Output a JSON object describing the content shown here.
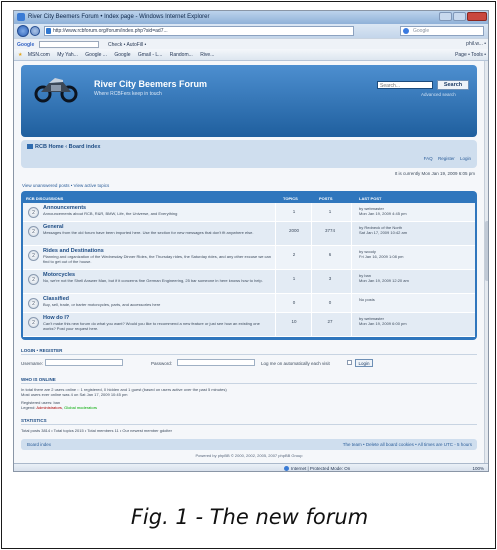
{
  "window": {
    "title": "River City Beemers Forum • Index page - Windows Internet Explorer",
    "url": "http://www.rcbforum.org/forum/index.php?sid=ad7...",
    "search_placeholder": "Google"
  },
  "googlebar": {
    "logo": "Google",
    "tools": "Check • AutoFill • ",
    "right": "phil.w... •"
  },
  "favorites": {
    "items": [
      "MSN.com",
      "My Yah...",
      "Google ...",
      "Google",
      "Gmail - L...",
      "Random...",
      "Rive..."
    ],
    "commands": "Page • Tools •"
  },
  "header": {
    "title": "River City Beemers Forum",
    "description": "Where RCBFers keep in touch",
    "search_placeholder": "Search...",
    "search_button": "Search",
    "advanced": "Advanced search"
  },
  "nav": {
    "breadcrumb": "RCB Home ‹ Board index",
    "faq": "FAQ",
    "register": "Register",
    "login": "Login",
    "current_time": "It is currently Mon Jan 19, 2009 6:05 pm"
  },
  "search_links": "View unanswered posts • View active topics",
  "forum_table": {
    "headers": {
      "forum": "RCB Discussions",
      "topics": "Topics",
      "posts": "Posts",
      "last_post": "Last post"
    },
    "rows": [
      {
        "name": "Announcements",
        "desc": "Announcements about RCB, R&R, BMW, Life, the Universe, and Everything",
        "topics": "1",
        "posts": "1",
        "last": "by webmaster\nMon Jan 19, 2009 4:45 pm"
      },
      {
        "name": "General",
        "desc": "Messages from the old forum have been imported here. Use the section for new messages that don't fit anywhere else.",
        "topics": "2000",
        "posts": "3774",
        "last": "by Redneck of the North\nSat Jan 17, 2009 10:42 am"
      },
      {
        "name": "Rides and Destinations",
        "desc": "Planning and organization of the Wednesday Dinner Rides, the Thursday rides, the Saturday rides, and any other excuse we can find to get out of the house.",
        "topics": "2",
        "posts": "6",
        "last": "by woody\nFri Jan 16, 2009 1:08 pm"
      },
      {
        "name": "Motorcycles",
        "desc": "No, we're not the Shell Answer Man, but if it concerns fine German Engineering, 25 bar someone in here knows how to help.",
        "topics": "1",
        "posts": "3",
        "last": "by ban\nMon Jan 19, 2009 12:20 am"
      },
      {
        "name": "Classified",
        "desc": "Buy, sell, trade, or barter motorcycles, parts, and accessories here",
        "topics": "0",
        "posts": "0",
        "last": "No posts"
      },
      {
        "name": "How do I?",
        "desc": "Can't make this new forum do what you want? Would you like to recommend a new feature or just see how an existing one works? Post your request here.",
        "topics": "10",
        "posts": "27",
        "last": "by webmaster\nMon Jan 19, 2009 6:00 pm"
      }
    ]
  },
  "login": {
    "heading": "Login • Register",
    "username_label": "Username:",
    "password_label": "Password:",
    "auto_label": "Log me on automatically each visit",
    "button": "Login"
  },
  "online": {
    "heading": "Who is online",
    "line1": "In total there are 2 users online :: 1 registered, 0 hidden and 1 guest (based on users active over the past 5 minutes)",
    "line2": "Most users ever online was 4 on Sat Jan 17, 2009 10:45 pm",
    "registered": "Registered users: ban",
    "legend_prefix": "Legend: ",
    "legend_admin": "Administrators",
    "legend_sep": ", ",
    "legend_mod": "Global moderators"
  },
  "stats": {
    "heading": "Statistics",
    "line": "Total posts 3814 • Total topics 2015 • Total members 11 • Our newest member gdolter"
  },
  "footer": {
    "board_index": "Board index",
    "right": "The team • Delete all board cookies • All times are UTC - 5 hours",
    "copyright": "Powered by phpBB © 2000, 2002, 2005, 2007 phpBB Group"
  },
  "status": {
    "zone": "Internet | Protected Mode: On",
    "zoom": "100%"
  },
  "caption": "Fig. 1 - The new forum"
}
